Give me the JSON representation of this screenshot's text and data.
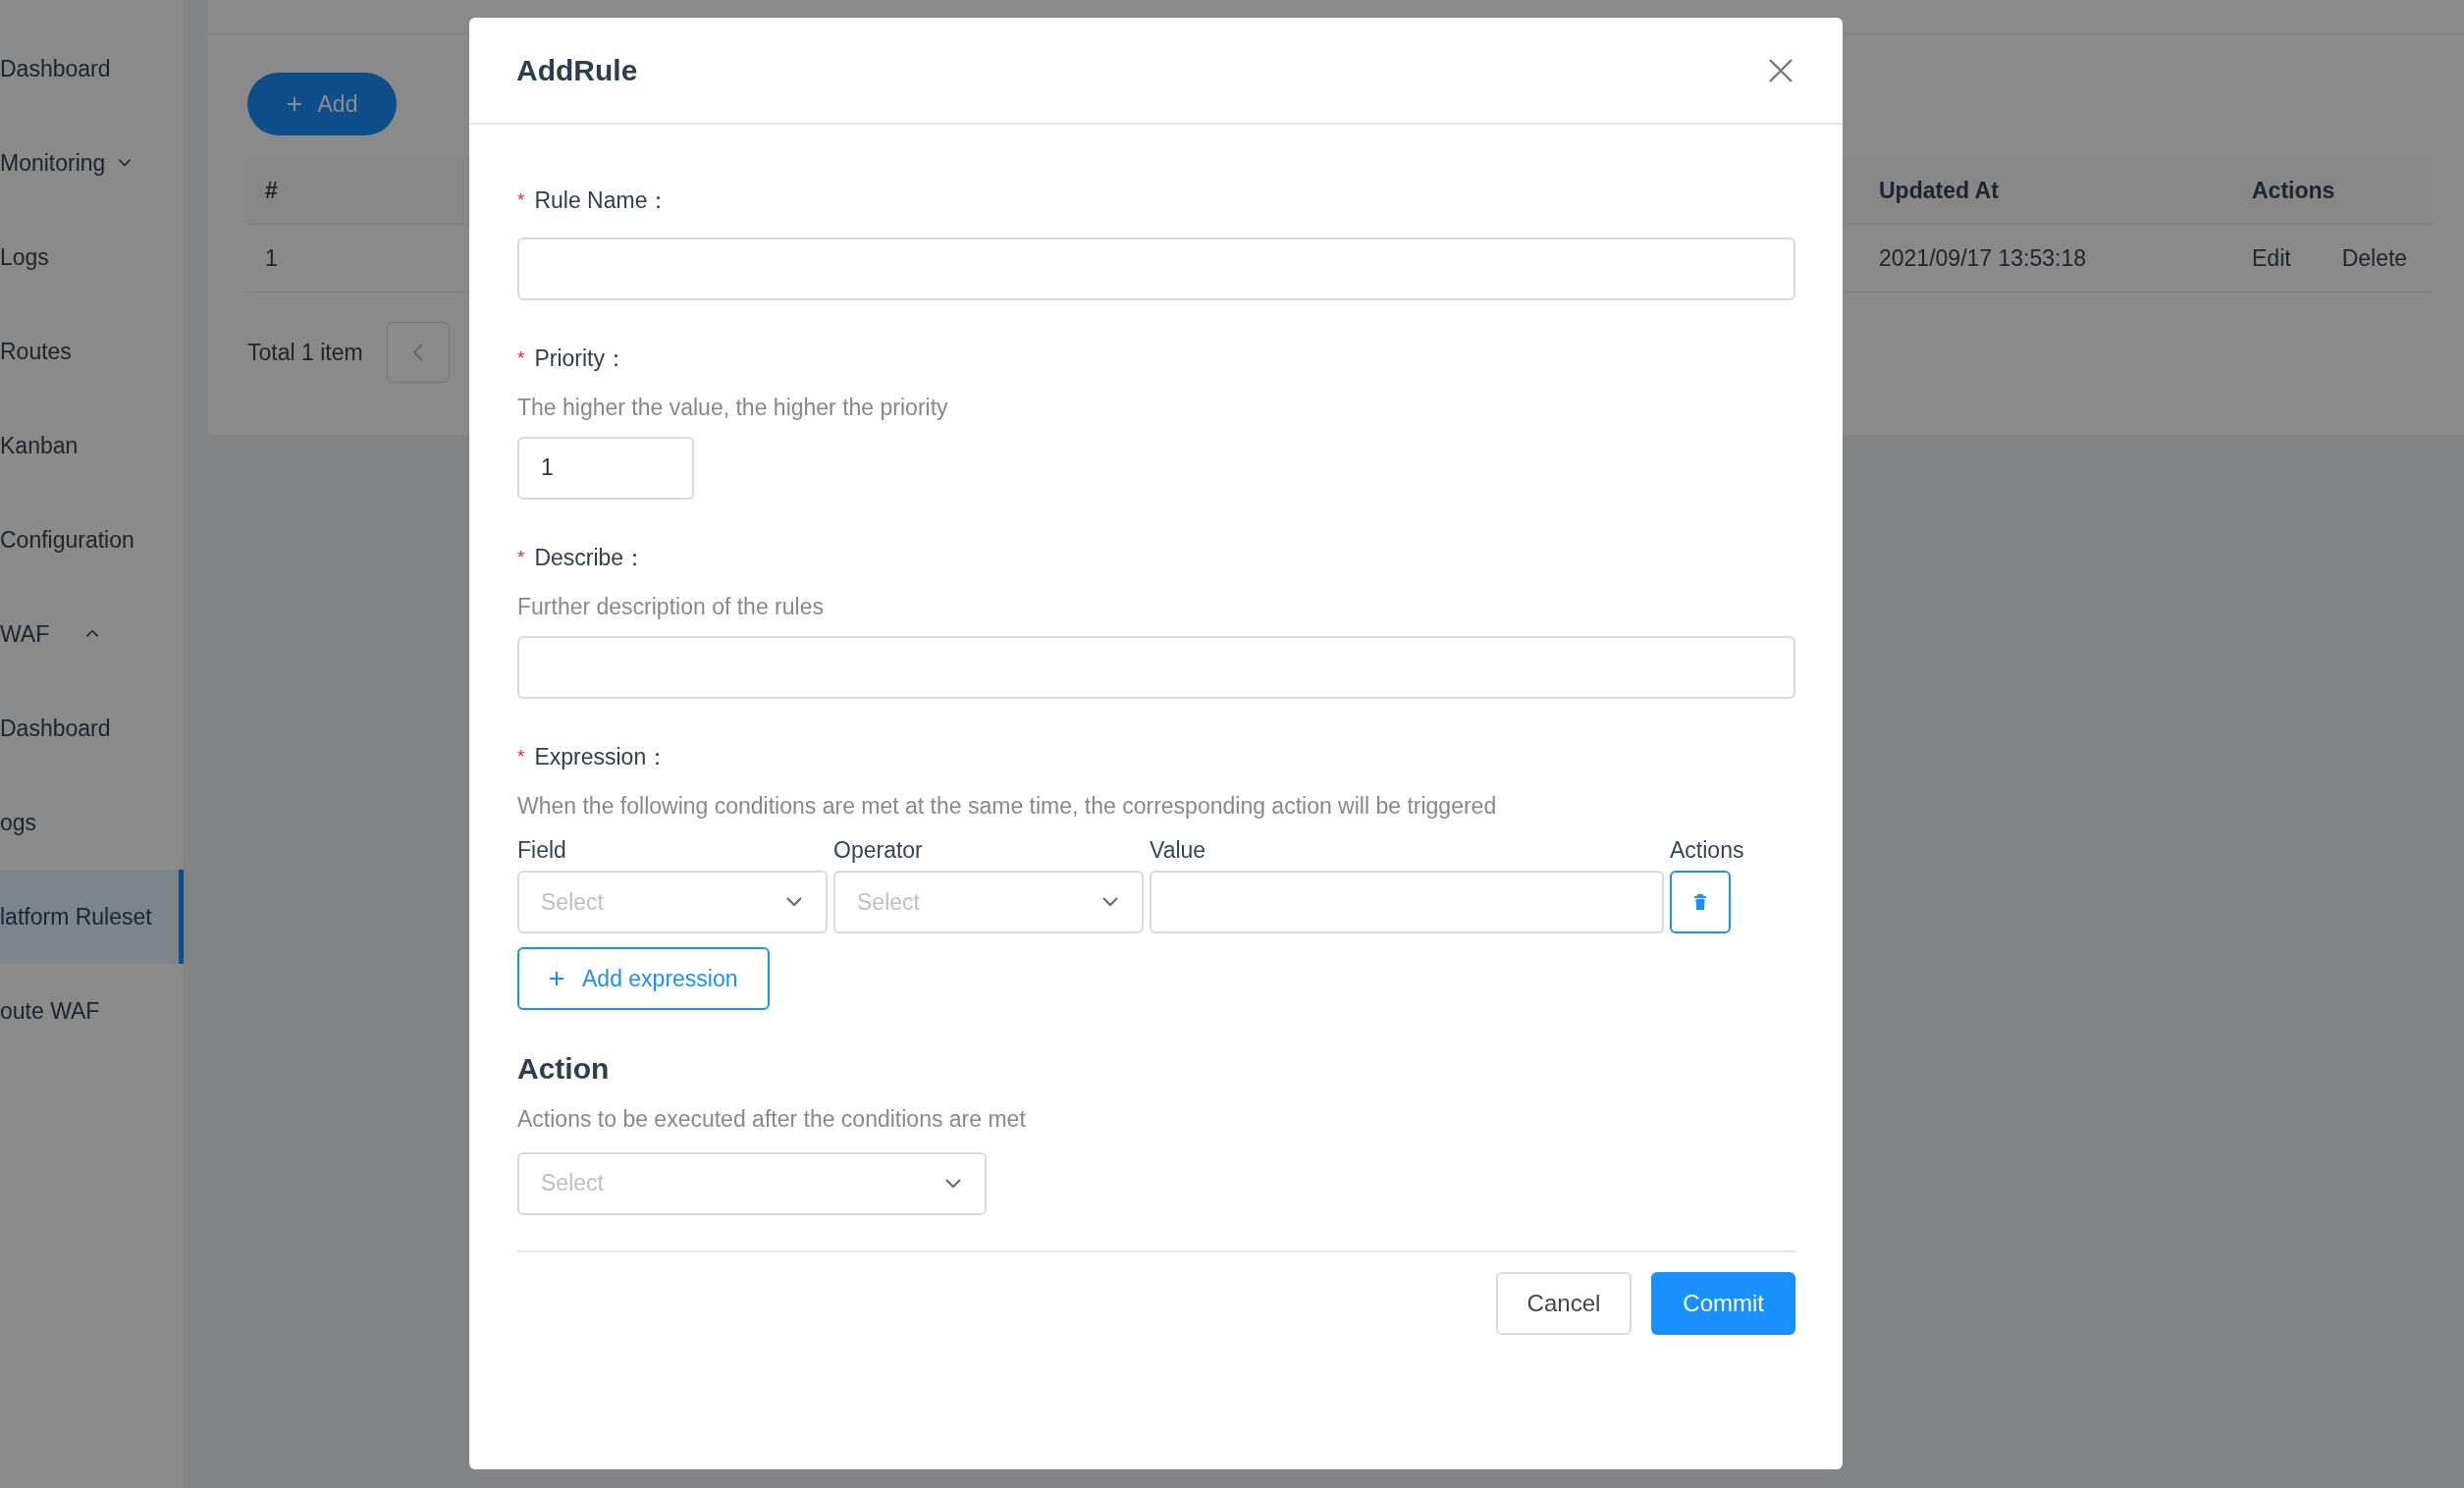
{
  "sidebar": {
    "items": [
      {
        "label": "Dashboard",
        "kind": "link",
        "selected": false
      },
      {
        "label": "Monitoring",
        "kind": "group",
        "expanded": false,
        "selected": false
      },
      {
        "label": "Logs",
        "kind": "link",
        "selected": false
      },
      {
        "label": "Routes",
        "kind": "link",
        "selected": false
      },
      {
        "label": "Kanban",
        "kind": "link",
        "selected": false
      },
      {
        "label": "Configuration",
        "kind": "link",
        "selected": false
      },
      {
        "label": "WAF",
        "kind": "group",
        "expanded": true,
        "selected": false,
        "children": [
          {
            "label": "Dashboard",
            "selected": false
          },
          {
            "label": "ogs",
            "selected": false
          },
          {
            "label": "latform Ruleset",
            "selected": true
          },
          {
            "label": "oute WAF",
            "selected": false
          }
        ]
      }
    ]
  },
  "page": {
    "add_button": "Add",
    "table": {
      "columns": [
        "#",
        "Updated At",
        "Actions"
      ],
      "rows": [
        {
          "number": "1",
          "updated_at": "2021/09/17 13:53:18",
          "actions": [
            "Edit",
            "Delete"
          ]
        }
      ]
    },
    "total": "Total 1 item"
  },
  "modal": {
    "title": "AddRule",
    "fields": [
      {
        "kind": "text",
        "required_mark": "*",
        "label": "Rule Name："
      },
      {
        "kind": "number",
        "required_mark": "*",
        "label": "Priority：",
        "hint": "The higher the value, the higher the priority",
        "value": "1"
      },
      {
        "kind": "text",
        "required_mark": "*",
        "label": "Describe：",
        "hint": "Further description of the rules"
      },
      {
        "kind": "expression",
        "required_mark": "*",
        "label": "Expression：",
        "hint": "When the following conditions are met at the same time, the corresponding action will be triggered",
        "columns": [
          "Field",
          "Operator",
          "Value",
          "Actions"
        ],
        "rows": [
          {
            "field_placeholder": "Select",
            "operator_placeholder": "Select"
          }
        ],
        "add_button": "Add expression"
      }
    ],
    "action": {
      "heading": "Action",
      "hint": "Actions to be executed after the conditions are met",
      "placeholder": "Select"
    },
    "buttons": [
      {
        "label": "Cancel",
        "kind": "default"
      },
      {
        "label": "Commit",
        "kind": "primary"
      }
    ]
  }
}
